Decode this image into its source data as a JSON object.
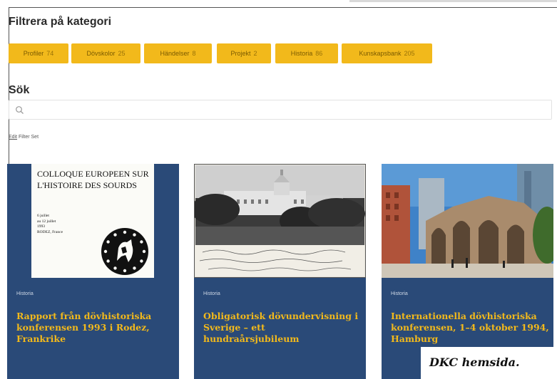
{
  "filter": {
    "title": "Filtrera på kategori",
    "chips": [
      {
        "label": "Profiler",
        "count": "74"
      },
      {
        "label": "Dövskolor",
        "count": "25"
      },
      {
        "label": "Händelser",
        "count": "8"
      },
      {
        "label": "Projekt",
        "count": "2"
      },
      {
        "label": "Historia",
        "count": "86"
      },
      {
        "label": "Kunskapsbank",
        "count": "205"
      }
    ]
  },
  "search": {
    "title": "Sök",
    "value": "",
    "placeholder": ""
  },
  "edit_link": {
    "label_underlined": "Edit",
    "label_rest": " Filter Set"
  },
  "cards": [
    {
      "category": "Historia",
      "title": "Rapport från dövhistoriska konferensen 1993 i Rodez, Frankrike",
      "poster": {
        "title": "COLLOQUE EUROPEEN SUR L'HISTOIRE DES SOURDS",
        "meta": "6 juillet\nau 12 juillet\n1993\nRODEZ, France"
      }
    },
    {
      "category": "Historia",
      "title": "Obligatorisk dövundervisning i Sverige – ett hundraårsjubileum"
    },
    {
      "category": "Historia",
      "title": "Internationella dövhistoriska konferensen, 1–4 oktober 1994, Hamburg"
    }
  ],
  "caption": "DKC hemsida.",
  "colors": {
    "chip_bg": "#f2b91b",
    "card_bg": "#2a4a78",
    "card_title": "#f2b91b"
  }
}
